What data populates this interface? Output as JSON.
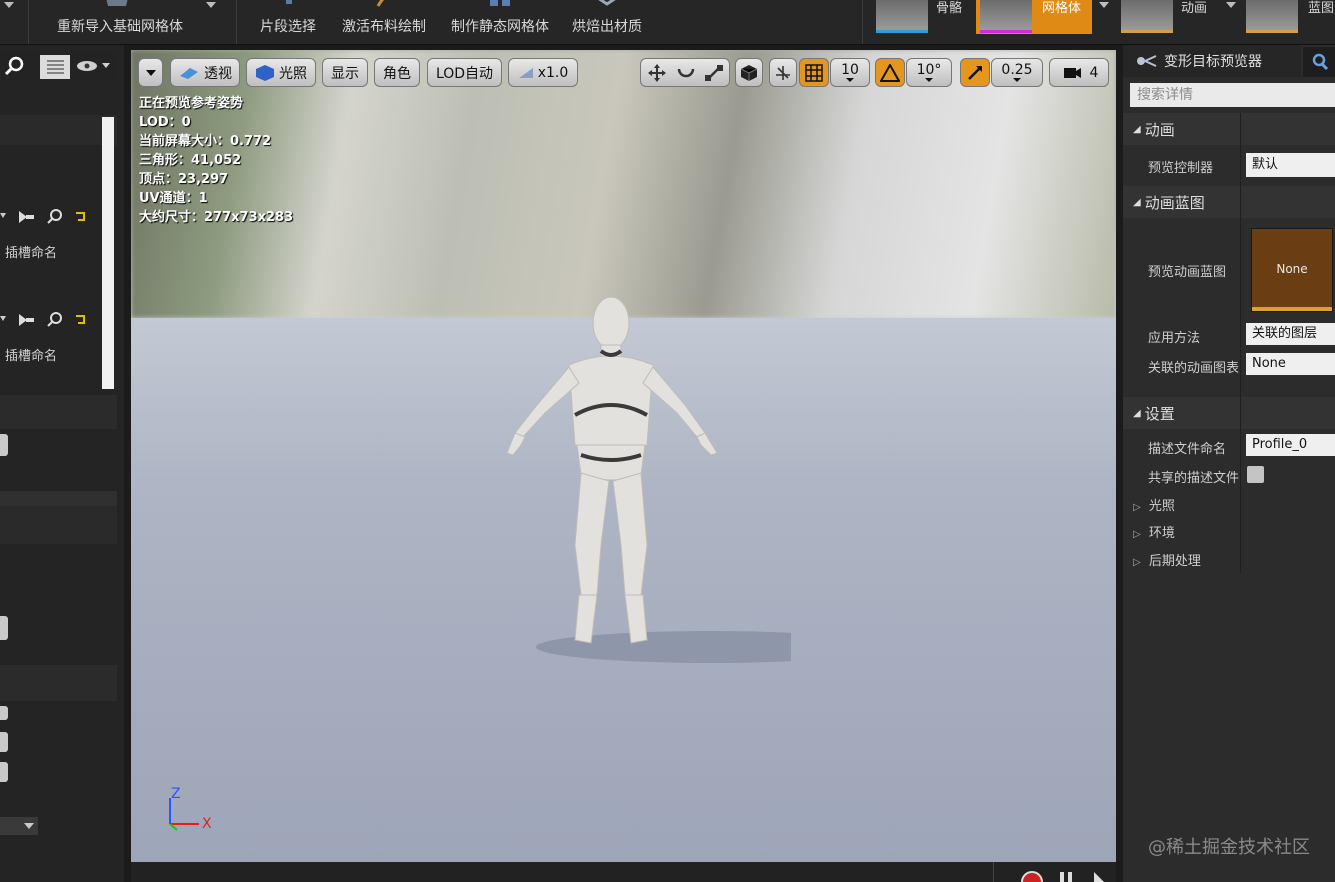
{
  "toolbar": {
    "reimport_label": "重新导入基础网格体",
    "section_select_label": "片段选择",
    "cloth_paint_label": "激活布料绘制",
    "make_static_mesh_label": "制作静态网格体",
    "bake_materials_label": "烘焙出材质",
    "modes": [
      {
        "label": "骨骼"
      },
      {
        "label": "网格体"
      },
      {
        "label": "动画"
      },
      {
        "label": "蓝图"
      }
    ]
  },
  "left_panel": {
    "slot_name_1": "插槽命名",
    "slot_name_2": "插槽命名"
  },
  "viewport": {
    "buttons": {
      "perspective": "透视",
      "lighting": "光照",
      "show": "显示",
      "character": "角色",
      "lod": "LOD自动",
      "speed": "x1.0",
      "grid_snap_value": "10",
      "rotation_snap_value": "10°",
      "scale_snap_value": "0.25",
      "camera_speed_value": "4"
    },
    "stats": [
      "正在预览参考姿势",
      "LOD：0",
      "当前屏幕大小：0.772",
      "三角形：41,052",
      "顶点：23,297",
      "UV通道：1",
      "大约尺寸：277x73x283"
    ],
    "axis": {
      "z": "Z",
      "x": "X"
    }
  },
  "right_panel": {
    "tab_title": "变形目标预览器",
    "search_placeholder": "搜索详情",
    "sections": {
      "animation": "动画",
      "anim_blueprint": "动画蓝图",
      "settings": "设置",
      "lighting": "光照",
      "environment": "环境",
      "post_process": "后期处理"
    },
    "props": {
      "preview_controller_label": "预览控制器",
      "preview_controller_value": "默认",
      "preview_anim_bp_label": "预览动画蓝图",
      "preview_anim_bp_value": "None",
      "apply_method_label": "应用方法",
      "apply_method_value": "关联的图层",
      "linked_anim_graph_label": "关联的动画图表",
      "linked_anim_graph_value": "None",
      "profile_name_label": "描述文件命名",
      "profile_name_value": "Profile_0",
      "shared_profile_label": "共享的描述文件"
    }
  },
  "watermark": "@稀土掘金技术社区",
  "colors": {
    "accent_orange": "#e4961e",
    "mode_active": "#e08a16",
    "mode_active_bar": "#d12ad6"
  }
}
